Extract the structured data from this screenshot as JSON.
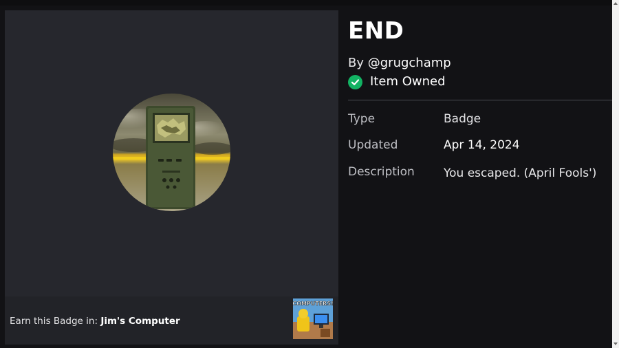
{
  "badge": {
    "title": "END",
    "by_prefix": "By",
    "creator": "@grugchamp",
    "owned_text": "Item Owned",
    "owned_color": "#12b363"
  },
  "details": {
    "type_label": "Type",
    "type_value": "Badge",
    "updated_label": "Updated",
    "updated_value": "Apr 14, 2024",
    "description_label": "Description",
    "description_value": "You escaped. (April Fools')"
  },
  "earn": {
    "prefix": "Earn this Badge in:",
    "game_name": "Jim's Computer",
    "thumbnail_text": "COMPUTERS!"
  },
  "icons": {
    "owned": "check-circle-icon",
    "badge_image": "handheld-device-badge-icon",
    "game_thumbnail": "game-thumbnail-image"
  }
}
